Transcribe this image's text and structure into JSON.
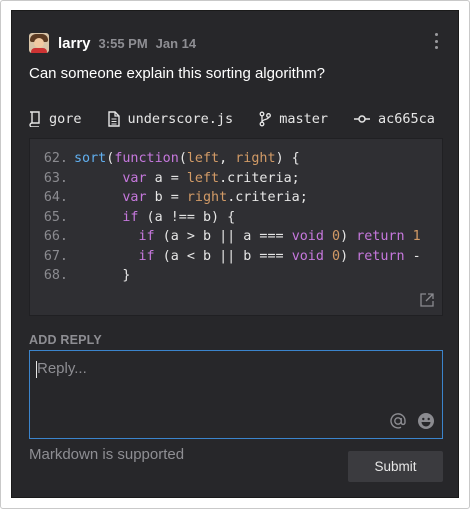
{
  "comment": {
    "username": "larry",
    "time": "3:55 PM",
    "date": "Jan 14",
    "message": "Can someone explain this sorting algorithm?",
    "avatar_icon": "user-avatar",
    "more_icon": "kebab-menu-icon"
  },
  "refs": {
    "repo": "gore",
    "file": "underscore.js",
    "branch": "master",
    "commit": "ac665ca"
  },
  "code": {
    "lines": [
      {
        "num": "62.",
        "text": "sort(function(left, right) {"
      },
      {
        "num": "63.",
        "text": "var a = left.criteria;"
      },
      {
        "num": "64.",
        "text": "var b = right.criteria;"
      },
      {
        "num": "65.",
        "text": "if (a !== b) {"
      },
      {
        "num": "66.",
        "text": "if (a > b || a === void 0) return 1"
      },
      {
        "num": "67.",
        "text": "if (a < b || b === void 0) return -"
      },
      {
        "num": "68.",
        "text": "}"
      }
    ]
  },
  "reply": {
    "section_label": "ADD REPLY",
    "placeholder": "Reply...",
    "value": "",
    "markdown_note": "Markdown is supported",
    "submit_label": "Submit"
  },
  "colors": {
    "panel_bg": "#27272a",
    "code_bg": "#2f2f33",
    "focus_border": "#3b84cc",
    "keyword": "#c678dd",
    "function": "#61afef",
    "argument": "#d19a66"
  }
}
